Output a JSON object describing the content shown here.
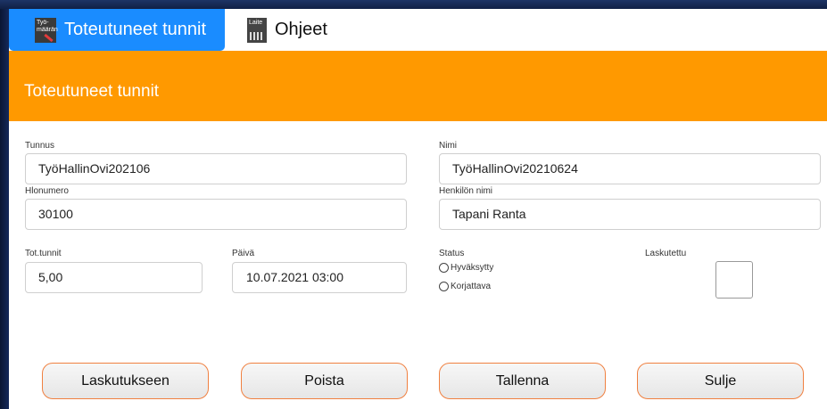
{
  "tabs": {
    "active": {
      "label": "Toteutuneet tunnit",
      "icon_text": "Työ- määrän",
      "icon": "time-report-icon"
    },
    "inactive": {
      "label": "Ohjeet",
      "icon_text": "Laite",
      "icon": "device-icon"
    }
  },
  "header": {
    "title": "Toteutuneet tunnit",
    "color": "#ff9900"
  },
  "form": {
    "tunnus": {
      "label": "Tunnus",
      "value": "TyöHallinOvi202106"
    },
    "nimi": {
      "label": "Nimi",
      "value": "TyöHallinOvi20210624"
    },
    "hlonumero": {
      "label": "Hlonumero",
      "value": "30100"
    },
    "henkilon_nimi": {
      "label": "Henkilön nimi",
      "value": "Tapani Ranta"
    },
    "tot_tunnit": {
      "label": "Tot.tunnit",
      "value": "5,00"
    },
    "paiva": {
      "label": "Päivä",
      "value": "10.07.2021 03:00"
    },
    "status": {
      "label": "Status",
      "options": [
        "Hyväksytty",
        "Korjattava"
      ]
    },
    "laskutettu": {
      "label": "Laskutettu"
    }
  },
  "buttons": {
    "laskutukseen": "Laskutukseen",
    "poista": "Poista",
    "tallenna": "Tallenna",
    "sulje": "Sulje"
  },
  "colors": {
    "accent": "#ff9900",
    "tab_active": "#1a8cff",
    "button_border": "#f08040"
  }
}
